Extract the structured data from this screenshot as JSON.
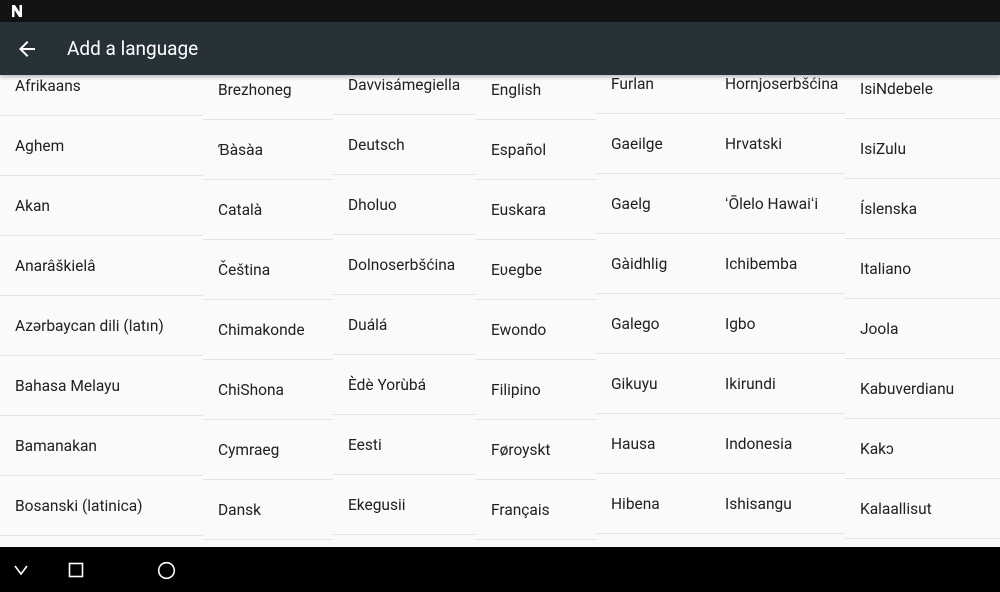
{
  "app_bar": {
    "title": "Add a language",
    "back_icon": "arrow-back-icon"
  },
  "status_bar": {
    "logo_icon": "n-logo-icon"
  },
  "nav_bar": {
    "back_icon": "nav-back-icon",
    "recents_icon": "recents-square-icon",
    "home_icon": "home-circle-icon"
  },
  "colors": {
    "app_bar": "#263238",
    "status_bar": "#111315",
    "nav_bar": "#000000",
    "background": "#fafafa",
    "text": "#212121",
    "divider": "#e3e3e3"
  },
  "columns": [
    {
      "items": [
        "Afrikaans",
        "Aghem",
        "Akan",
        "Anarâškielâ",
        "Azərbaycan dili (latın)",
        "Bahasa Melayu",
        "Bamanakan",
        "Bosanski (latinica)"
      ]
    },
    {
      "items": [
        "Brezhoneg",
        "Ɓàsàa",
        "Català",
        "Čeština",
        "Chimakonde",
        "ChiShona",
        "Cymraeg",
        "Dansk"
      ]
    },
    {
      "items": [
        "Davvisámegiella",
        "Deutsch",
        "Dholuo",
        "Dolnoserbšćina",
        "Duálá",
        "Èdè Yorùbá",
        "Eesti",
        "Ekegusii"
      ]
    },
    {
      "items": [
        "English",
        "Español",
        "Euskara",
        "Eʋegbe",
        "Ewondo",
        "Filipino",
        "Føroyskt",
        "Français"
      ]
    },
    {
      "items": [
        "Furlan",
        "Gaeilge",
        "Gaelg",
        "Gàidhlig",
        "Galego",
        "Gikuyu",
        "Hausa",
        "Hibena"
      ]
    },
    {
      "items": [
        "Hornjoserbšćina",
        "Hrvatski",
        "ʻŌlelo Hawaiʻi",
        "Ichibemba",
        "Igbo",
        "Ikirundi",
        "Indonesia",
        "Ishisangu"
      ]
    },
    {
      "items": [
        "IsiNdebele",
        "IsiZulu",
        "Íslenska",
        "Italiano",
        "Joola",
        "Kabuverdianu",
        "Kakɔ",
        "Kalaallisut"
      ]
    }
  ]
}
